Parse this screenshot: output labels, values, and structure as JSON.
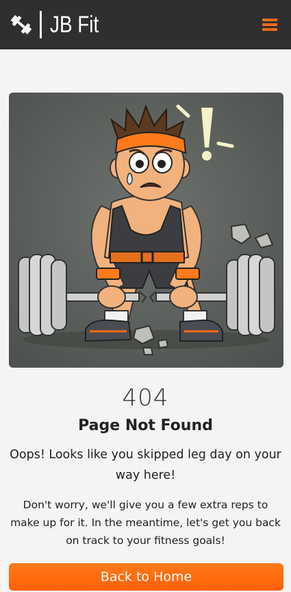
{
  "header": {
    "brand_text": "JB Fit",
    "logo_icon": "dumbbell-logo-icon",
    "menu_icon": "hamburger-menu-icon",
    "background_color": "#2f2f2f",
    "accent_color": "#ff6a13"
  },
  "hero": {
    "illustration": "cartoon-weightlifter-broken-barbell",
    "exclamation": "!"
  },
  "error": {
    "code": "404",
    "title": "Page Not Found",
    "lead": "Oops! Looks like you skipped leg day on your way here!",
    "message": "Don't worry, we'll give you a few extra reps to make up for it. In the meantime, let's get you back on track to your fitness goals!"
  },
  "actions": {
    "home_label": "Back to Home",
    "button_color": "#ff6a13"
  }
}
